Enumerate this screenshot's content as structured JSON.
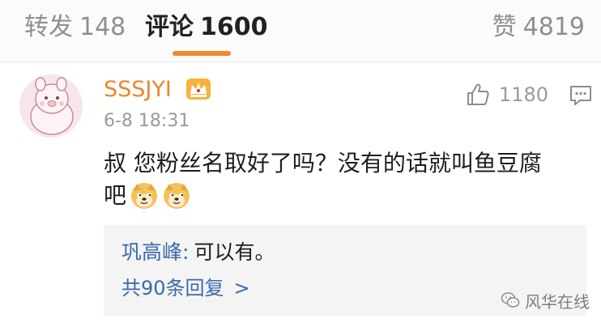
{
  "tabs": {
    "repost": {
      "label": "转发",
      "count": "148"
    },
    "comments": {
      "label": "评论",
      "count": "1600"
    },
    "likes": {
      "label": "赞",
      "count": "4819"
    },
    "active": "comments"
  },
  "comment": {
    "username": "SSSJYI",
    "timestamp": "6-8 18:31",
    "like_count": "1180",
    "text_line1": "叔 您粉丝名取好了吗？没有的话就叫鱼豆腐",
    "text_line2": "吧",
    "emojis": [
      "doge-icon",
      "doge-icon"
    ]
  },
  "reply": {
    "author": "巩高峰",
    "separator": ":",
    "text": "可以有。",
    "more_label": "共90条回复",
    "more_chevron": ">"
  },
  "watermark": {
    "text": "风华在线",
    "icon": "wechat-icon"
  },
  "colors": {
    "accent": "#f08a2b",
    "username": "#f0832a",
    "link": "#3a6aa8",
    "muted": "#9a9a9a"
  }
}
